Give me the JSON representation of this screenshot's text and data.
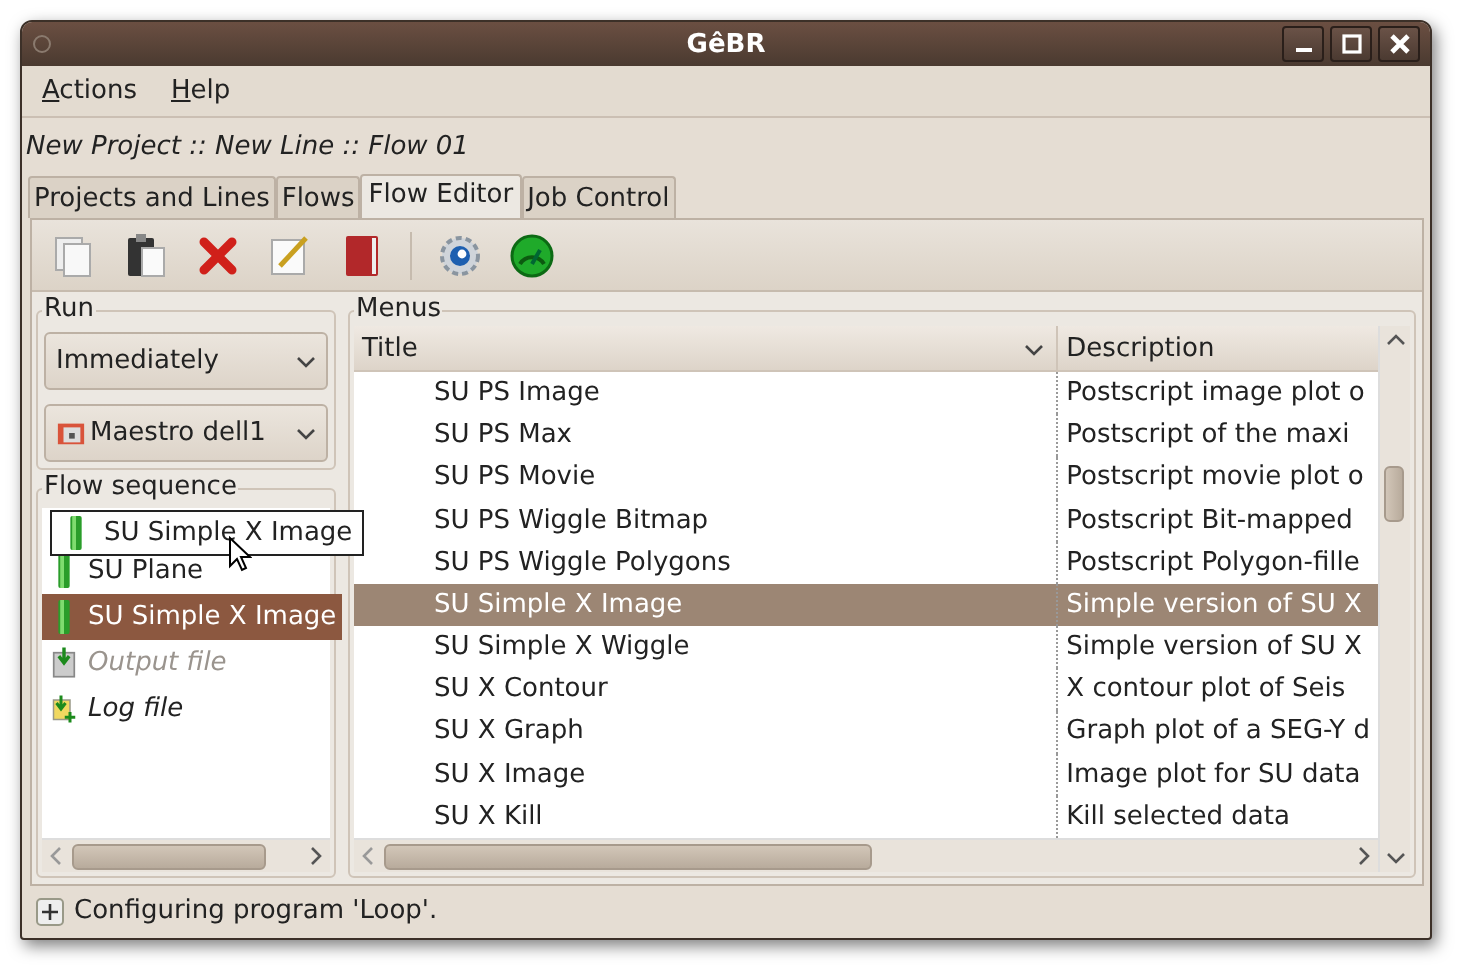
{
  "window": {
    "title": "GêBR"
  },
  "menu": [
    {
      "label": "Actions"
    },
    {
      "label": "Help"
    }
  ],
  "breadcrumb": "New Project :: New Line :: Flow 01",
  "tabs": [
    {
      "label": "Projects and Lines",
      "selected": false
    },
    {
      "label": "Flows",
      "selected": false
    },
    {
      "label": "Flow Editor",
      "selected": true
    },
    {
      "label": "Job Control",
      "selected": false
    }
  ],
  "run": {
    "label": "Run",
    "schedule": "Immediately",
    "server": "Maestro dell1"
  },
  "flow_sequence": {
    "label": "Flow sequence",
    "drag_item": "SU Simple X Image",
    "items": [
      {
        "kind": "program",
        "label": "SU Plane",
        "selected": false,
        "disabled": false
      },
      {
        "kind": "program",
        "label": "SU Simple X Image",
        "selected": true,
        "disabled": false
      },
      {
        "kind": "output",
        "label": "Output file",
        "selected": false,
        "disabled": true
      },
      {
        "kind": "log",
        "label": "Log file",
        "selected": false,
        "disabled": false
      }
    ]
  },
  "menus": {
    "label": "Menus",
    "columns": [
      "Title",
      "Description"
    ],
    "rows": [
      {
        "title": "SU PS Image",
        "description": "Postscript image plot o",
        "selected": false
      },
      {
        "title": "SU PS Max",
        "description": "Postscript of the maxi",
        "selected": false
      },
      {
        "title": "SU PS Movie",
        "description": "Postscript movie plot o",
        "selected": false
      },
      {
        "title": "SU PS Wiggle Bitmap",
        "description": "Postscript Bit-mapped",
        "selected": false
      },
      {
        "title": "SU PS Wiggle Polygons",
        "description": "Postscript Polygon-fille",
        "selected": false
      },
      {
        "title": "SU Simple X Image",
        "description": "Simple version of SU X",
        "selected": true
      },
      {
        "title": "SU Simple X Wiggle",
        "description": "Simple version of SU X",
        "selected": false
      },
      {
        "title": "SU X Contour",
        "description": "X contour plot of Seis",
        "selected": false
      },
      {
        "title": "SU X Graph",
        "description": "Graph plot of a SEG-Y d",
        "selected": false
      },
      {
        "title": "SU X Image",
        "description": "Image plot for SU data",
        "selected": false
      },
      {
        "title": "SU X Kill",
        "description": "Kill selected data",
        "selected": false
      }
    ]
  },
  "status_bar": {
    "text": "Configuring program 'Loop'."
  }
}
